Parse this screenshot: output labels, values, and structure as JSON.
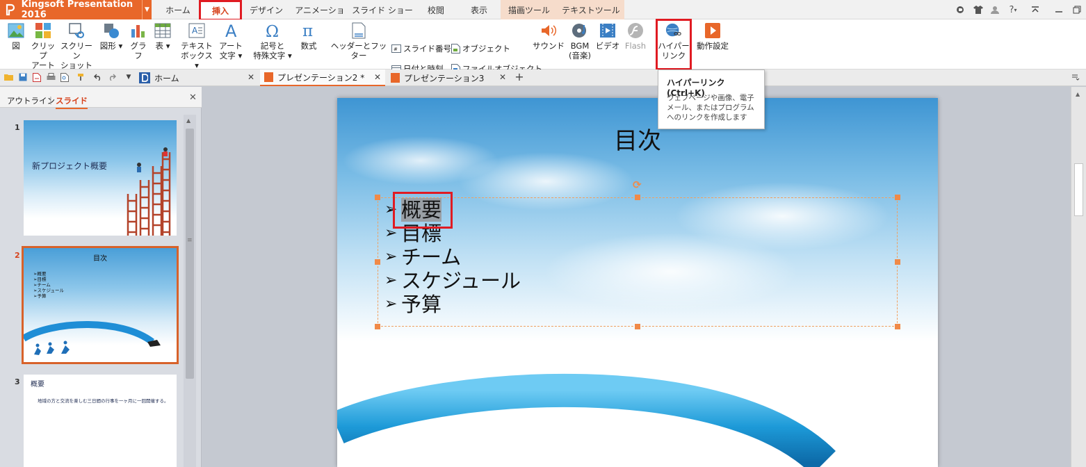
{
  "app": {
    "title": "Kingsoft Presentation 2016"
  },
  "menu": {
    "tabs": [
      {
        "label": "ホーム"
      },
      {
        "label": "挿入"
      },
      {
        "label": "デザイン"
      },
      {
        "label": "アニメーション"
      },
      {
        "label": "スライド ショー"
      },
      {
        "label": "校閲"
      },
      {
        "label": "表示"
      },
      {
        "label": "描画ツール"
      },
      {
        "label": "テキストツール"
      }
    ],
    "help_label": "?"
  },
  "ribbon": {
    "picture": "図",
    "clipart_1": "クリップ",
    "clipart_2": "アート",
    "screenshot_1": "スクリーン",
    "screenshot_2": "ショット",
    "shape": "図形",
    "chart": "グラフ",
    "table": "表",
    "textbox_1": "テキスト",
    "textbox_2": "ボックス",
    "wordart_1": "アート",
    "wordart_2": "文字",
    "symbol_1": "記号と",
    "symbol_2": "特殊文字",
    "equation": "数式",
    "header_footer": "ヘッダーとフッター",
    "slide_number": "スライド番号",
    "datetime": "日付と時刻",
    "object": "オブジェクト",
    "file_object": "ファイルオブジェクト",
    "sound": "サウンド",
    "bgm_1": "BGM",
    "bgm_2": "(音楽)",
    "video": "ビデオ",
    "flash": "Flash",
    "hyperlink_1": "ハイパー",
    "hyperlink_2": "リンク",
    "action": "動作設定"
  },
  "doc_tabs": [
    {
      "label": "ホーム"
    },
    {
      "label": "プレゼンテーション2 *"
    },
    {
      "label": "プレゼンテーション3"
    }
  ],
  "panel": {
    "outline_tab": "アウトライン",
    "separator": "|",
    "slides_tab": "スライド",
    "slides": [
      {
        "num": "1",
        "title": "新プロジェクト概要"
      },
      {
        "num": "2",
        "title": "目次",
        "bullets": [
          "概要",
          "目標",
          "チーム",
          "スケジュール",
          "予算"
        ]
      },
      {
        "num": "3",
        "title": "概要",
        "body": "地域の方と交流を楽しむ三日間の行事を一ヶ月に一回開催する。"
      }
    ]
  },
  "slide": {
    "title": "目次",
    "bullets": [
      "概要",
      "目標",
      "チーム",
      "スケジュール",
      "予算"
    ],
    "bullet_glyph": "➢"
  },
  "tooltip": {
    "title": "ハイパーリンク (Ctrl+K)",
    "desc": "ウェブページや画像、電子メール、またはプログラムへのリンクを作成します"
  },
  "colors": {
    "accent": "#e8672a",
    "highlight": "#e01b22",
    "selected_tab_text": "#d6421c"
  }
}
